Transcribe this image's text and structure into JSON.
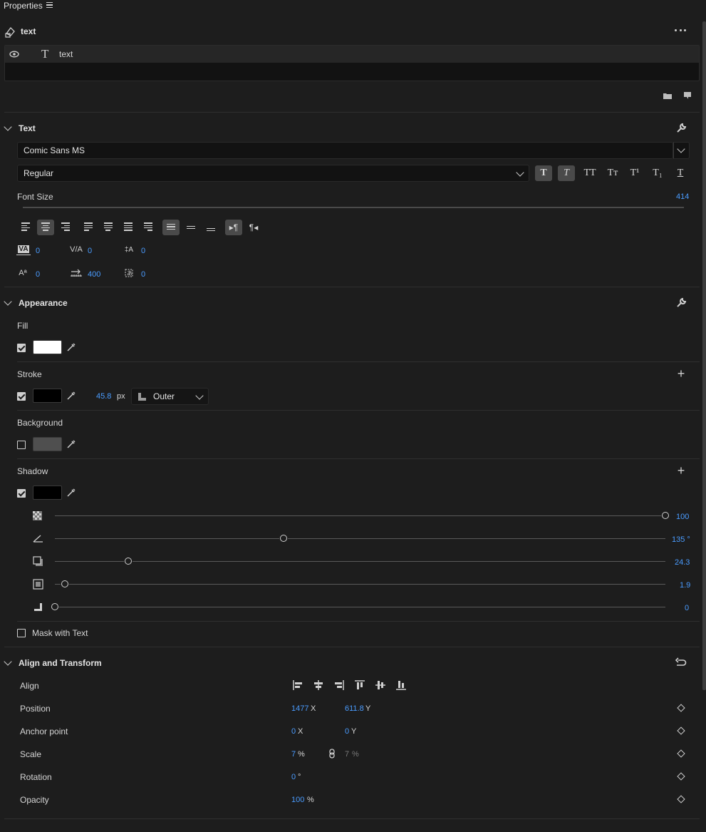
{
  "panel": {
    "title": "Properties"
  },
  "clip": {
    "name": "text"
  },
  "layer": {
    "name": "text"
  },
  "text_section": {
    "title": "Text",
    "font_family": "Comic Sans MS",
    "font_style": "Regular",
    "font_size_label": "Font Size",
    "font_size_value": "414",
    "style_buttons": [
      "T",
      "T",
      "TT",
      "Tт",
      "T¹",
      "T₁",
      "T"
    ],
    "metrics": {
      "kerning": "0",
      "tracking": "0",
      "leading": "0",
      "baseline_shift": "0",
      "tab_width": "400",
      "tsume": "0"
    }
  },
  "appearance": {
    "title": "Appearance",
    "fill": {
      "label": "Fill",
      "enabled": true,
      "color": "#ffffff"
    },
    "stroke": {
      "label": "Stroke",
      "enabled": true,
      "color": "#000000",
      "width": "45.8",
      "unit": "px",
      "position": "Outer"
    },
    "background": {
      "label": "Background",
      "enabled": false,
      "color": "#4f4f4f"
    },
    "shadow": {
      "label": "Shadow",
      "enabled": true,
      "color": "#000000",
      "opacity": {
        "value": "100",
        "fraction": 1.0
      },
      "angle": {
        "value": "135 °",
        "fraction": 0.375
      },
      "distance": {
        "value": "24.3",
        "fraction": 0.12
      },
      "size": {
        "value": "1.9",
        "fraction": 0.016
      },
      "blur": {
        "value": "0",
        "fraction": 0.0
      }
    },
    "mask_with_text": {
      "label": "Mask with Text",
      "enabled": false
    }
  },
  "align_transform": {
    "title": "Align and Transform",
    "align_label": "Align",
    "position": {
      "label": "Position",
      "x": "1477",
      "y": "611.8",
      "x_axis": "X",
      "y_axis": "Y"
    },
    "anchor": {
      "label": "Anchor point",
      "x": "0",
      "y": "0",
      "x_axis": "X",
      "y_axis": "Y"
    },
    "scale": {
      "label": "Scale",
      "value": "7",
      "unit": "%",
      "value2": "7",
      "unit2": "%"
    },
    "rotation": {
      "label": "Rotation",
      "value": "0",
      "unit": "°"
    },
    "opacity": {
      "label": "Opacity",
      "value": "100",
      "unit": "%"
    }
  },
  "colors": {
    "accent": "#4a9cff",
    "bg": "#1d1d1d"
  }
}
